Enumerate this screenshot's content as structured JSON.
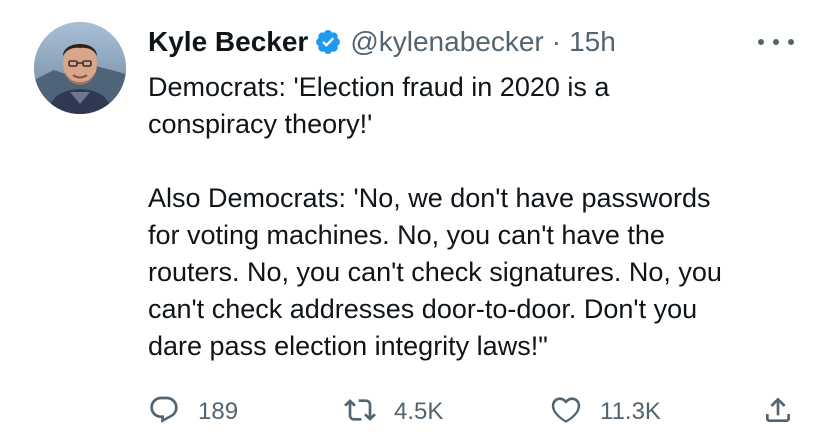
{
  "author": {
    "name": "Kyle Becker",
    "handle": "@kylenabecker",
    "separator": "·",
    "time": "15h",
    "verified": true
  },
  "tweet": {
    "text": "Democrats: 'Election fraud in 2020 is a\nconspiracy theory!'\n\nAlso Democrats: 'No, we don't have passwords\nfor voting machines. No, you can't have the\nrouters. No, you can't check signatures. No, you\ncan't check addresses door-to-door. Don't you\ndare pass election integrity laws!\""
  },
  "actions": {
    "reply": {
      "icon": "reply-icon",
      "count": "189"
    },
    "retweet": {
      "icon": "retweet-icon",
      "count": "4.5K"
    },
    "like": {
      "icon": "heart-icon",
      "count": "11.3K"
    },
    "share": {
      "icon": "share-icon",
      "count": ""
    }
  },
  "colors": {
    "text": "#0f1419",
    "secondary": "#536471",
    "verified": "#1d9bf0",
    "background": "#ffffff"
  }
}
